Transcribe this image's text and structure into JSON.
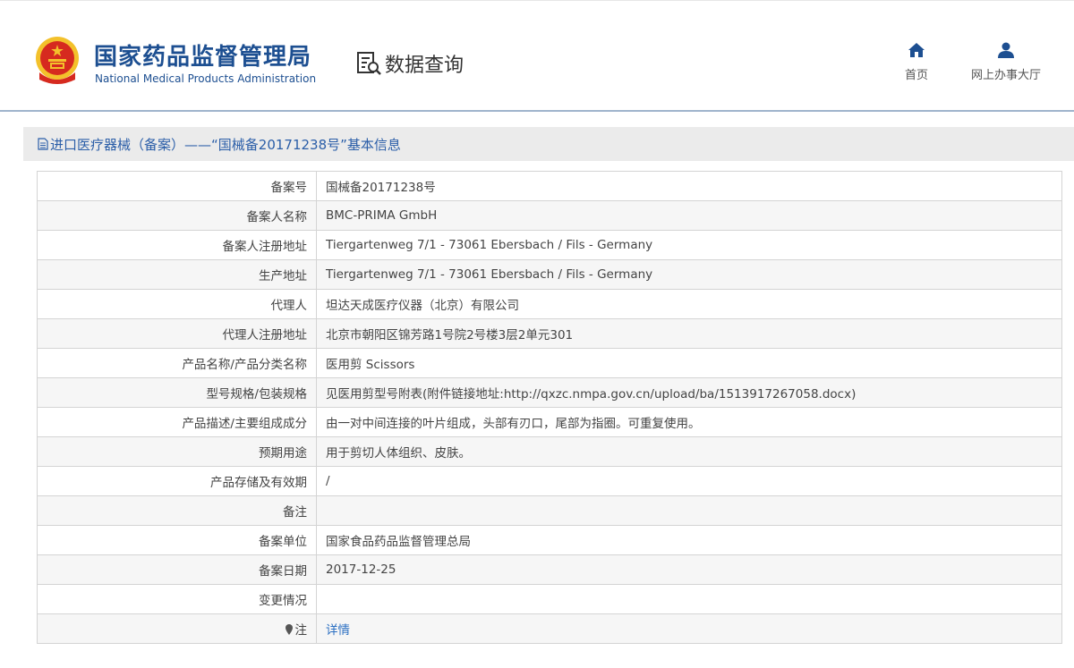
{
  "header": {
    "org_name_cn": "国家药品监督管理局",
    "org_name_en": "National Medical Products Administration",
    "section_title": "数据查询",
    "nav": [
      {
        "label": "首页",
        "icon": "home-icon"
      },
      {
        "label": "网上办事大厅",
        "icon": "user-icon"
      }
    ]
  },
  "colors": {
    "brand_blue": "#1d4f91",
    "link_blue": "#2b6fc2",
    "panel_bg": "#ebebeb",
    "emblem_red": "#d62a1f",
    "emblem_gold": "#f3c12b"
  },
  "panel": {
    "title": "进口医疗器械（备案）——“国械备20171238号”基本信息",
    "icon": "document-icon"
  },
  "rows": [
    {
      "label": "备案号",
      "value": "国械备20171238号"
    },
    {
      "label": "备案人名称",
      "value": "BMC-PRIMA GmbH"
    },
    {
      "label": "备案人注册地址",
      "value": "Tiergartenweg 7/1 - 73061 Ebersbach / Fils - Germany"
    },
    {
      "label": "生产地址",
      "value": "Tiergartenweg 7/1 - 73061 Ebersbach / Fils - Germany"
    },
    {
      "label": "代理人",
      "value": "坦达天成医疗仪器（北京）有限公司"
    },
    {
      "label": "代理人注册地址",
      "value": "北京市朝阳区锦芳路1号院2号楼3层2单元301"
    },
    {
      "label": "产品名称/产品分类名称",
      "value": "医用剪 Scissors"
    },
    {
      "label": "型号规格/包装规格",
      "value": "见医用剪型号附表(附件链接地址:http://qxzc.nmpa.gov.cn/upload/ba/1513917267058.docx)"
    },
    {
      "label": "产品描述/主要组成成分",
      "value": "由一对中间连接的叶片组成，头部有刃口，尾部为指圈。可重复使用。"
    },
    {
      "label": "预期用途",
      "value": "用于剪切人体组织、皮肤。"
    },
    {
      "label": "产品存储及有效期",
      "value": "/"
    },
    {
      "label": "备注",
      "value": ""
    },
    {
      "label": "备案单位",
      "value": "国家食品药品监督管理总局"
    },
    {
      "label": "备案日期",
      "value": "2017-12-25"
    },
    {
      "label": "变更情况",
      "value": ""
    }
  ],
  "note_row": {
    "label": "注",
    "icon": "pin-icon",
    "link_text": "详情"
  }
}
